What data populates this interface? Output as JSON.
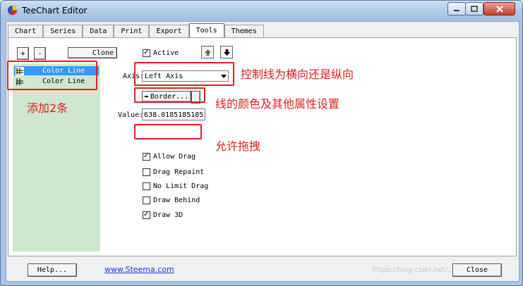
{
  "window": {
    "title": "TeeChart Editor"
  },
  "tabs": [
    {
      "label": "Chart"
    },
    {
      "label": "Series"
    },
    {
      "label": "Data"
    },
    {
      "label": "Print"
    },
    {
      "label": "Export"
    },
    {
      "label": "Tools"
    },
    {
      "label": "Themes"
    }
  ],
  "toolbar": {
    "add_label": "+",
    "remove_label": "-",
    "clone_label": "Clone",
    "active_label": "Active",
    "active_checked": true
  },
  "tools_list": [
    {
      "label": "Color Line",
      "selected": true
    },
    {
      "label": "Color Line",
      "selected": false
    }
  ],
  "axis": {
    "label": "Axis:",
    "value": "Left Axis"
  },
  "border_button": {
    "label": "Border..."
  },
  "value_field": {
    "label": "Value:",
    "value": "638.018518518518"
  },
  "options": [
    {
      "label": "Allow Drag",
      "checked": true
    },
    {
      "label": "Drag Repaint",
      "checked": false
    },
    {
      "label": "No Limit Drag",
      "checked": false
    },
    {
      "label": "Draw Behind",
      "checked": false
    },
    {
      "label": "Draw 3D",
      "checked": true
    }
  ],
  "annotations": {
    "axis_note": "控制线为横向还是纵向",
    "add_note": "添加2条",
    "border_note": "线的颜色及其他属性设置",
    "drag_note": "允许拖拽"
  },
  "footer": {
    "help_label": "Help...",
    "link_text": "www.Steema.com",
    "watermark": "https://blog.csdn.net/...",
    "close_label": "Close"
  },
  "colors": {
    "annotation": "#e02020",
    "selection": "#3399ff",
    "list_background": "#cfe7cf"
  }
}
